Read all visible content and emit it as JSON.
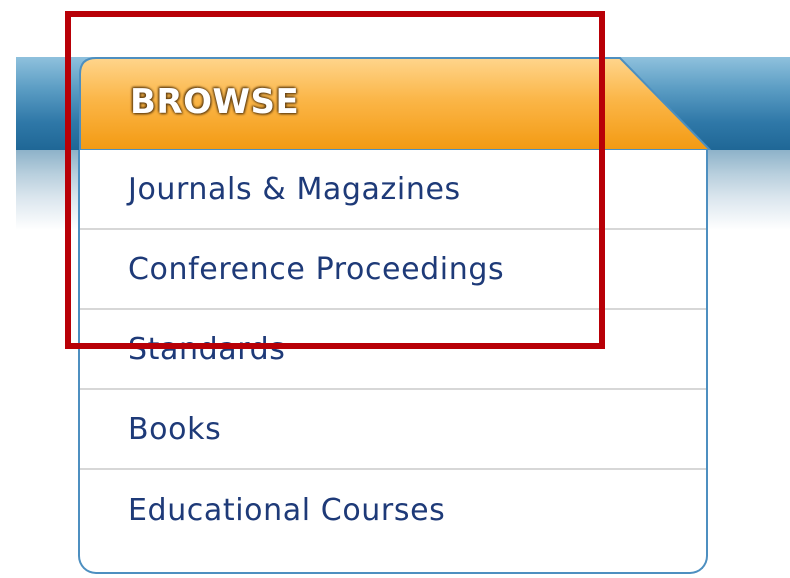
{
  "browse": {
    "title": "BROWSE",
    "items": [
      {
        "label": "Journals & Magazines"
      },
      {
        "label": "Conference Proceedings"
      },
      {
        "label": "Standards"
      },
      {
        "label": "Books"
      },
      {
        "label": "Educational Courses"
      }
    ]
  },
  "colors": {
    "header_orange": "#f7a21c",
    "header_orange_light": "#fccb73",
    "band_blue": "#1f6796",
    "panel_border": "#4d8fc0",
    "link_text": "#1e3a78",
    "highlight_red": "#b80007"
  }
}
